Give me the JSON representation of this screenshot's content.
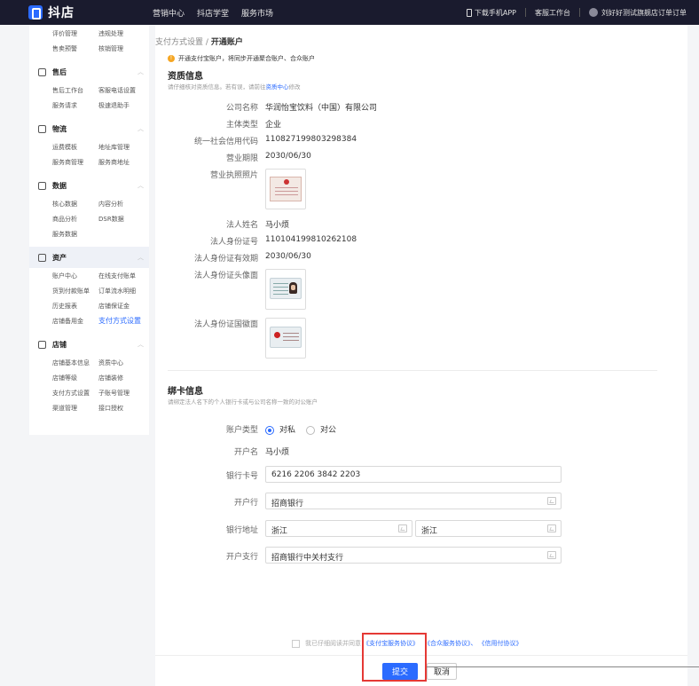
{
  "topbar": {
    "logo": "抖店",
    "nav": [
      "营销中心",
      "抖店学堂",
      "服务市场"
    ],
    "download": "下载手机APP",
    "service": "客服工作台",
    "user": "刘好好测试旗舰店订单订单"
  },
  "sidebar": {
    "top_rows": [
      [
        "评价管理",
        "违规处理"
      ],
      [
        "售卖预警",
        "核销管理"
      ]
    ],
    "groups": [
      {
        "title": "售后",
        "icon": "headset-icon",
        "rows": [
          [
            "售后工作台",
            "客服电话设置"
          ],
          [
            "服务请求",
            "极速退助手"
          ]
        ]
      },
      {
        "title": "物流",
        "icon": "truck-icon",
        "rows": [
          [
            "运费模板",
            "地址库管理"
          ],
          [
            "服务商管理",
            "服务商地址"
          ]
        ]
      },
      {
        "title": "数据",
        "icon": "chart-icon",
        "rows": [
          [
            "核心数据",
            "内容分析"
          ],
          [
            "商品分析",
            "DSR数据"
          ],
          [
            "服务数据",
            ""
          ]
        ]
      },
      {
        "title": "资产",
        "icon": "wallet-icon",
        "rows": [
          [
            "账户中心",
            "在线支付账单"
          ],
          [
            "货到付款账单",
            "订单流水明细"
          ],
          [
            "历史报表",
            "店铺保证金"
          ],
          [
            "店铺备用金",
            "支付方式设置"
          ]
        ]
      },
      {
        "title": "店铺",
        "icon": "store-icon",
        "rows": [
          [
            "店铺基本信息",
            "资质中心"
          ],
          [
            "店铺等级",
            "店铺装修"
          ],
          [
            "支付方式设置",
            "子账号管理"
          ],
          [
            "渠道管理",
            "接口授权"
          ]
        ]
      }
    ],
    "active_item": "支付方式设置"
  },
  "breadcrumb": {
    "parent": "支付方式设置",
    "sep": "/",
    "current": "开通账户"
  },
  "notice": "开通支付宝账户，将同步开通聚合账户、合众账户",
  "qualification": {
    "title": "资质信息",
    "subtitle_pre": "请仔细核对资质信息。若有误，请前往",
    "subtitle_link": "资质中心",
    "subtitle_post": "修改",
    "fields": {
      "company_label": "公司名称",
      "company": "华润怡宝饮料（中国）有限公司",
      "type_label": "主体类型",
      "type": "企业",
      "credit_label": "统一社会信用代码",
      "credit": "110827199803298384",
      "term_label": "营业期限",
      "term": "2030/06/30",
      "license_label": "营业执照照片",
      "legal_name_label": "法人姓名",
      "legal_name": "马小烦",
      "id_label": "法人身份证号",
      "id": "110104199810262108",
      "id_valid_label": "法人身份证有效期",
      "id_valid": "2030/06/30",
      "id_front_label": "法人身份证头像面",
      "id_back_label": "法人身份证国徽面"
    }
  },
  "bank": {
    "title": "绑卡信息",
    "subtitle": "请绑定法人名下的个人银行卡或与公司名称一致的对公账户",
    "account_type_label": "账户类型",
    "account_type_options": [
      "对私",
      "对公"
    ],
    "account_type_selected": "对私",
    "holder_label": "开户名",
    "holder": "马小烦",
    "card_label": "银行卡号",
    "card": "6216 2206 3842 2203",
    "bank_label": "开户行",
    "bank": "招商银行",
    "address_label": "银行地址",
    "province": "浙江",
    "city": "浙江",
    "branch_label": "开户支行",
    "branch": "招商银行中关村支行"
  },
  "agreement": {
    "text": "我已仔细阅读并同意",
    "link1": "《支付宝服务协议》",
    "link2": "《合众服务协议》、",
    "link3": "《信用付协议》"
  },
  "footer": {
    "submit": "提交",
    "cancel": "取消"
  },
  "colors": {
    "accent": "#2b6bff",
    "topbar": "#1a1b2e",
    "highlight": "#e53935"
  }
}
